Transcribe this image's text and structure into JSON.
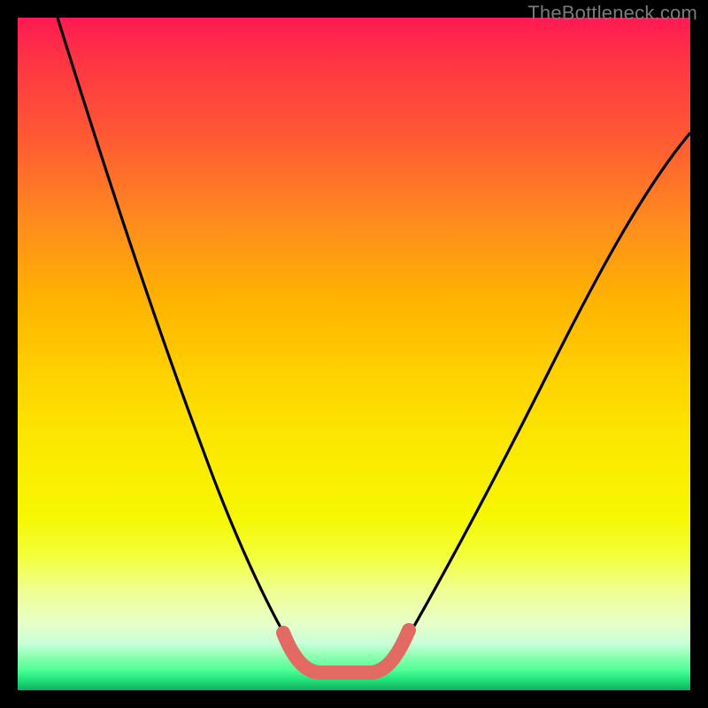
{
  "watermark": "TheBottleneck.com",
  "chart_data": {
    "type": "line",
    "title": "",
    "xlabel": "",
    "ylabel": "",
    "xlim": [
      0,
      100
    ],
    "ylim": [
      0,
      100
    ],
    "grid": false,
    "legend": false,
    "annotations": [],
    "series": [
      {
        "name": "bottleneck-curve",
        "stroke": "#000000",
        "x": [
          6,
          10,
          14,
          18,
          22,
          26,
          30,
          34,
          37,
          40,
          42,
          44,
          46,
          48,
          50,
          52,
          54,
          57,
          62,
          68,
          74,
          80,
          86,
          92,
          98
        ],
        "values": [
          99,
          87,
          76,
          66,
          56,
          47,
          38,
          30,
          22,
          15,
          10,
          6,
          4,
          3,
          3,
          4,
          6,
          10,
          18,
          28,
          38,
          47,
          55,
          62,
          68
        ]
      },
      {
        "name": "highlight-segment",
        "stroke": "#e26a62",
        "x": [
          40,
          42,
          44,
          46,
          48,
          50,
          52,
          54,
          56
        ],
        "values": [
          15,
          10,
          6,
          4,
          3,
          3,
          4,
          6,
          10
        ]
      }
    ],
    "background_gradient": {
      "top": "#ff1a53",
      "mid": "#ffe500",
      "bottom": "#0fb05e"
    }
  }
}
